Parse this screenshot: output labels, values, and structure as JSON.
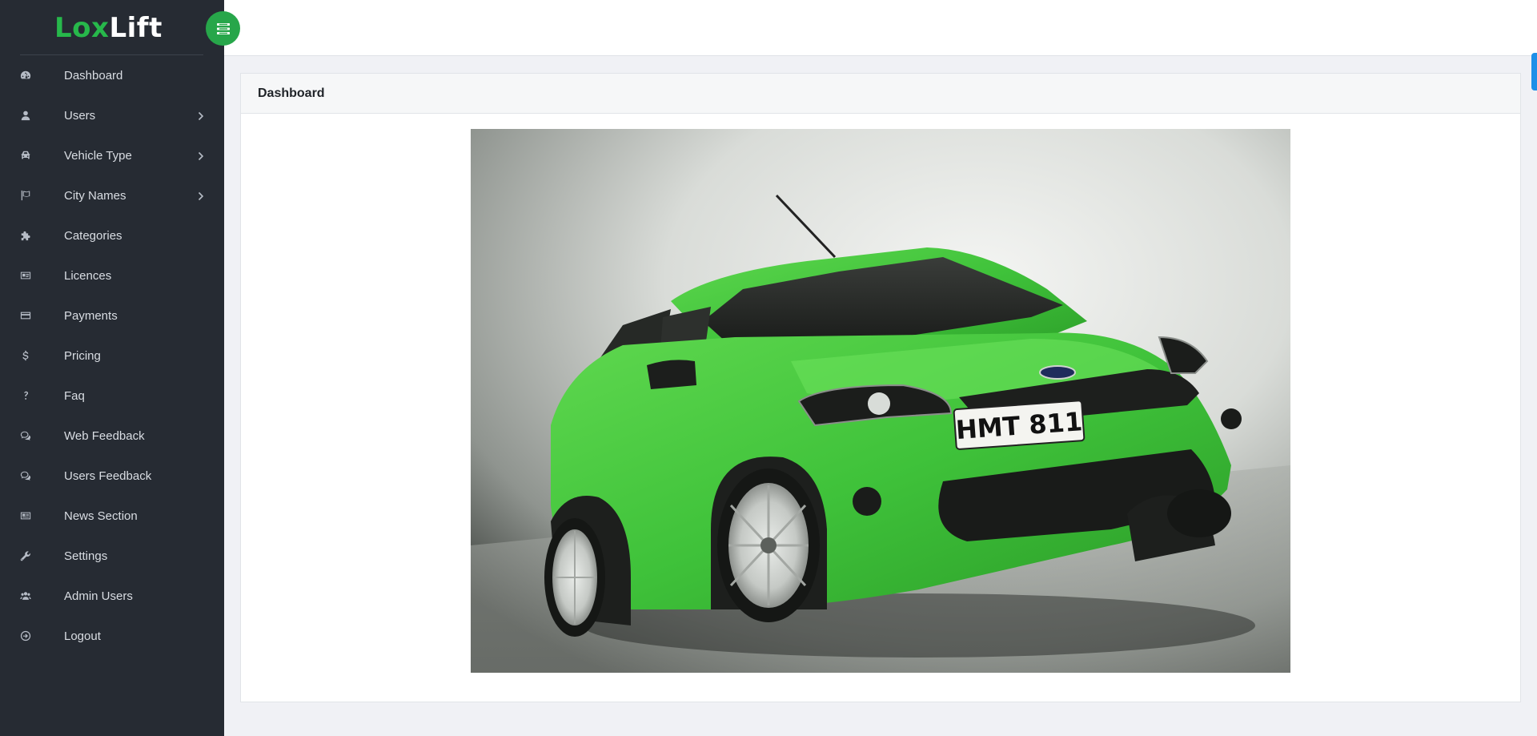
{
  "brand": {
    "part1": "Lox",
    "part2": "Lift"
  },
  "menu": [
    {
      "label": "Dashboard",
      "icon": "dashboard-icon",
      "submenu": false
    },
    {
      "label": "Users",
      "icon": "user-icon",
      "submenu": true
    },
    {
      "label": "Vehicle Type",
      "icon": "car-icon",
      "submenu": true
    },
    {
      "label": "City Names",
      "icon": "flag-icon",
      "submenu": true
    },
    {
      "label": "Categories",
      "icon": "puzzle-icon",
      "submenu": false
    },
    {
      "label": "Licences",
      "icon": "id-card-icon",
      "submenu": false
    },
    {
      "label": "Payments",
      "icon": "credit-card-icon",
      "submenu": false
    },
    {
      "label": "Pricing",
      "icon": "dollar-icon",
      "submenu": false
    },
    {
      "label": "Faq",
      "icon": "question-icon",
      "submenu": false
    },
    {
      "label": "Web Feedback",
      "icon": "comments-icon",
      "submenu": false
    },
    {
      "label": "Users Feedback",
      "icon": "comments-icon",
      "submenu": false
    },
    {
      "label": "News Section",
      "icon": "newspaper-icon",
      "submenu": false
    },
    {
      "label": "Settings",
      "icon": "wrench-icon",
      "submenu": false
    },
    {
      "label": "Admin Users",
      "icon": "users-icon",
      "submenu": false
    },
    {
      "label": "Logout",
      "icon": "logout-icon",
      "submenu": false
    }
  ],
  "card": {
    "title": "Dashboard"
  },
  "plate": {
    "text": "HMT 811"
  },
  "colors": {
    "sidebar_bg": "#262b33",
    "brand_green": "#27b84b",
    "toggle_green": "#27a64a",
    "accent_blue": "#1e8fe8",
    "car_green": "#3fc23a"
  }
}
